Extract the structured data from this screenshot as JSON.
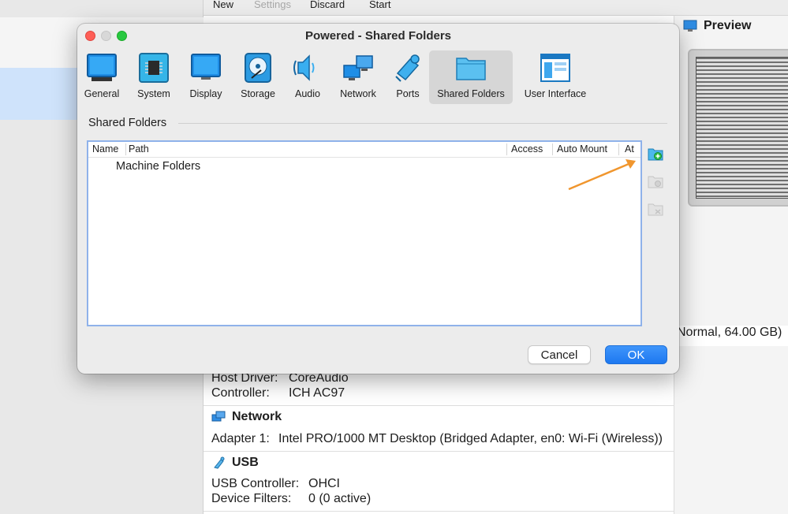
{
  "background": {
    "toolbar": {
      "new": "New",
      "settings": "Settings",
      "discard": "Discard",
      "start": "Start"
    },
    "preview": {
      "title": "Preview"
    },
    "storage_tail": "Normal, 64.00 GB)",
    "audio": {
      "host_driver_label": "Host Driver:",
      "host_driver_value": "CoreAudio",
      "controller_label": "Controller:",
      "controller_value": "ICH AC97"
    },
    "network": {
      "title": "Network",
      "adapter_label": "Adapter 1:",
      "adapter_value": "Intel PRO/1000 MT Desktop (Bridged Adapter, en0: Wi-Fi (Wireless))"
    },
    "usb": {
      "title": "USB",
      "controller_label": "USB Controller:",
      "controller_value": "OHCI",
      "filters_label": "Device Filters:",
      "filters_value": "0 (0 active)"
    }
  },
  "dialog": {
    "title": "Powered - Shared Folders",
    "tabs": [
      {
        "label": "General",
        "icon": "general-icon"
      },
      {
        "label": "System",
        "icon": "system-icon"
      },
      {
        "label": "Display",
        "icon": "display-icon"
      },
      {
        "label": "Storage",
        "icon": "storage-icon"
      },
      {
        "label": "Audio",
        "icon": "audio-icon"
      },
      {
        "label": "Network",
        "icon": "network-icon"
      },
      {
        "label": "Ports",
        "icon": "ports-icon"
      },
      {
        "label": "Shared Folders",
        "icon": "shared-folders-icon",
        "active": true
      },
      {
        "label": "User Interface",
        "icon": "user-interface-icon"
      }
    ],
    "section_title": "Shared Folders",
    "table": {
      "columns": {
        "name": "Name",
        "path": "Path",
        "access": "Access",
        "auto_mount": "Auto Mount",
        "at": "At"
      },
      "rows": [
        {
          "label": "Machine Folders"
        }
      ]
    },
    "side_buttons": [
      "add-folder-icon",
      "edit-folder-icon",
      "remove-folder-icon"
    ],
    "buttons": {
      "cancel": "Cancel",
      "ok": "OK"
    },
    "colors": {
      "accent": "#1d78f0",
      "table_focus": "#8fb2ea",
      "annotation_arrow": "#f0962e"
    }
  }
}
